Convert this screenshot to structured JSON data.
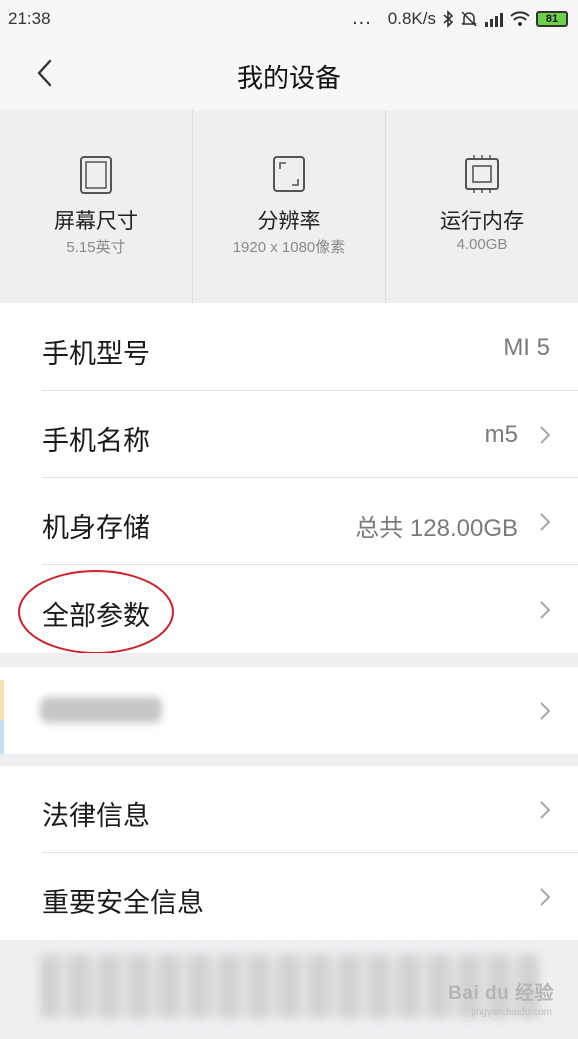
{
  "status_bar": {
    "time": "21:38",
    "more": "...",
    "network_speed": "0.8K/s",
    "battery_level": "81"
  },
  "header": {
    "title": "我的设备"
  },
  "specs": [
    {
      "icon": "screen-size-icon",
      "title": "屏幕尺寸",
      "value": "5.15英寸"
    },
    {
      "icon": "resolution-icon",
      "title": "分辨率",
      "value": "1920 x 1080像素"
    },
    {
      "icon": "memory-chip-icon",
      "title": "运行内存",
      "value": "4.00GB"
    }
  ],
  "list": {
    "model": {
      "label": "手机型号",
      "value": "MI 5"
    },
    "name": {
      "label": "手机名称",
      "value": "m5"
    },
    "storage": {
      "label": "机身存储",
      "value": "总共 128.00GB"
    },
    "all_params": {
      "label": "全部参数"
    }
  },
  "legal": {
    "legal_info": {
      "label": "法律信息"
    },
    "safety_info": {
      "label": "重要安全信息"
    }
  },
  "watermark": {
    "brand": "Bai du 经验",
    "url": "jingyan.baidu.com"
  },
  "colors": {
    "highlight": "#d0202a",
    "battery": "#6cd04a"
  }
}
